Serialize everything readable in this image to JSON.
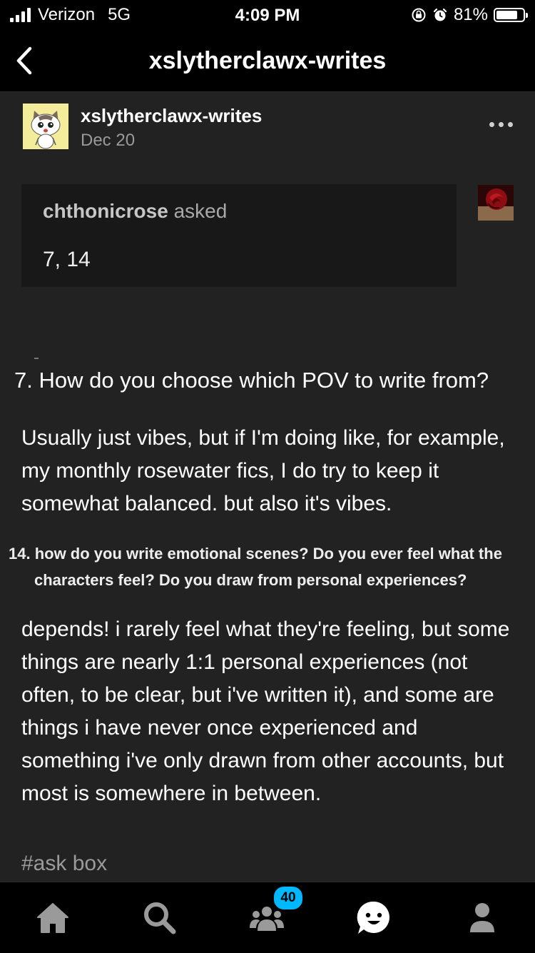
{
  "status_bar": {
    "carrier": "Verizon",
    "network": "5G",
    "time": "4:09 PM",
    "battery_percent": "81%",
    "battery_level": 0.81,
    "icons": [
      "signal-icon",
      "rotation-lock-icon",
      "alarm-icon",
      "battery-icon"
    ]
  },
  "nav": {
    "title": "xslytherclawx-writes",
    "back_icon": "chevron-left-icon"
  },
  "post": {
    "blog_name": "xslytherclawx-writes",
    "date": "Dec 20",
    "more_icon": "ellipsis-icon",
    "ask": {
      "asker": "chthonicrose",
      "asked_word": "asked",
      "text": "7, 14"
    },
    "q7": "7. How do you choose which POV to write from?",
    "a7": "Usually just vibes, but if I'm doing like, for example, my monthly rosewater fics, I do try to keep it somewhat balanced. but also it's vibes.",
    "q14_line1": "14. how do you write emotional scenes? Do you ever feel what the",
    "q14_line2": "characters feel? Do you draw from personal experiences?",
    "a14": "depends! i rarely feel what they're feeling, but some things are nearly 1:1 personal experiences (not often, to be clear, but i've written it), and some are things i have never once experienced and something i've only drawn from other accounts, but most is somewhere in between.",
    "tag": "#ask box"
  },
  "tab_bar": {
    "tabs": [
      "home-icon",
      "search-icon",
      "community-icon",
      "messages-icon",
      "account-icon"
    ],
    "community_badge": "40"
  },
  "colors": {
    "background": "#000000",
    "post_background": "#222222",
    "ask_background": "#181818",
    "badge": "#00b8ff"
  }
}
